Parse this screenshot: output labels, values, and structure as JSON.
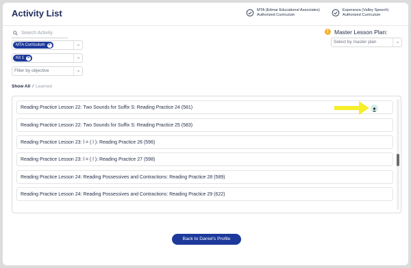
{
  "header": {
    "title": "Activity List",
    "badges": [
      {
        "line1": "MTA (Edmar Educational Associates)",
        "line2": "Authorized Curriculum"
      },
      {
        "line1": "Esperanza (Valley Speech)",
        "line2": "Authorized Curriculum"
      }
    ]
  },
  "filters": {
    "search_placeholder": "Search Activity",
    "curriculum_chip": "MTA Curriculum",
    "kit_chip": "Kit 1",
    "objective_placeholder": "Filter by objective"
  },
  "master_lesson_plan": {
    "label": "Master Lesson Plan:",
    "placeholder": "Select by master plan"
  },
  "tabs": {
    "show_all": "Show All",
    "separator": "/",
    "learned": "Learned"
  },
  "activities": [
    {
      "label": "Reading Practice Lesson 22: Two Sounds for Suffix S: Reading Practice 24 (581)"
    },
    {
      "label": "Reading Practice Lesson 22: Two Sounds for Suffix S: Reading Practice 25 (583)"
    },
    {
      "label": "Reading Practice Lesson 23: l = ( l ): Reading Practice 26 (596)"
    },
    {
      "label": "Reading Practice Lesson 23: l = ( l ): Reading Practice 27 (598)"
    },
    {
      "label": "Reading Practice Lesson 24: Reading Possessives and Contractions: Reading Practice 28 (589)"
    },
    {
      "label": "Reading Practice Lesson 24: Reading Possessives and Contractions: Reading Practice 29 (622)"
    }
  ],
  "back_button": "Back to Daniel's Profile",
  "colors": {
    "brand_blue": "#1d3a9b",
    "arrow_yellow": "#f5ee2a",
    "warning": "#f2b233",
    "person_bg": "#d6ece6"
  }
}
